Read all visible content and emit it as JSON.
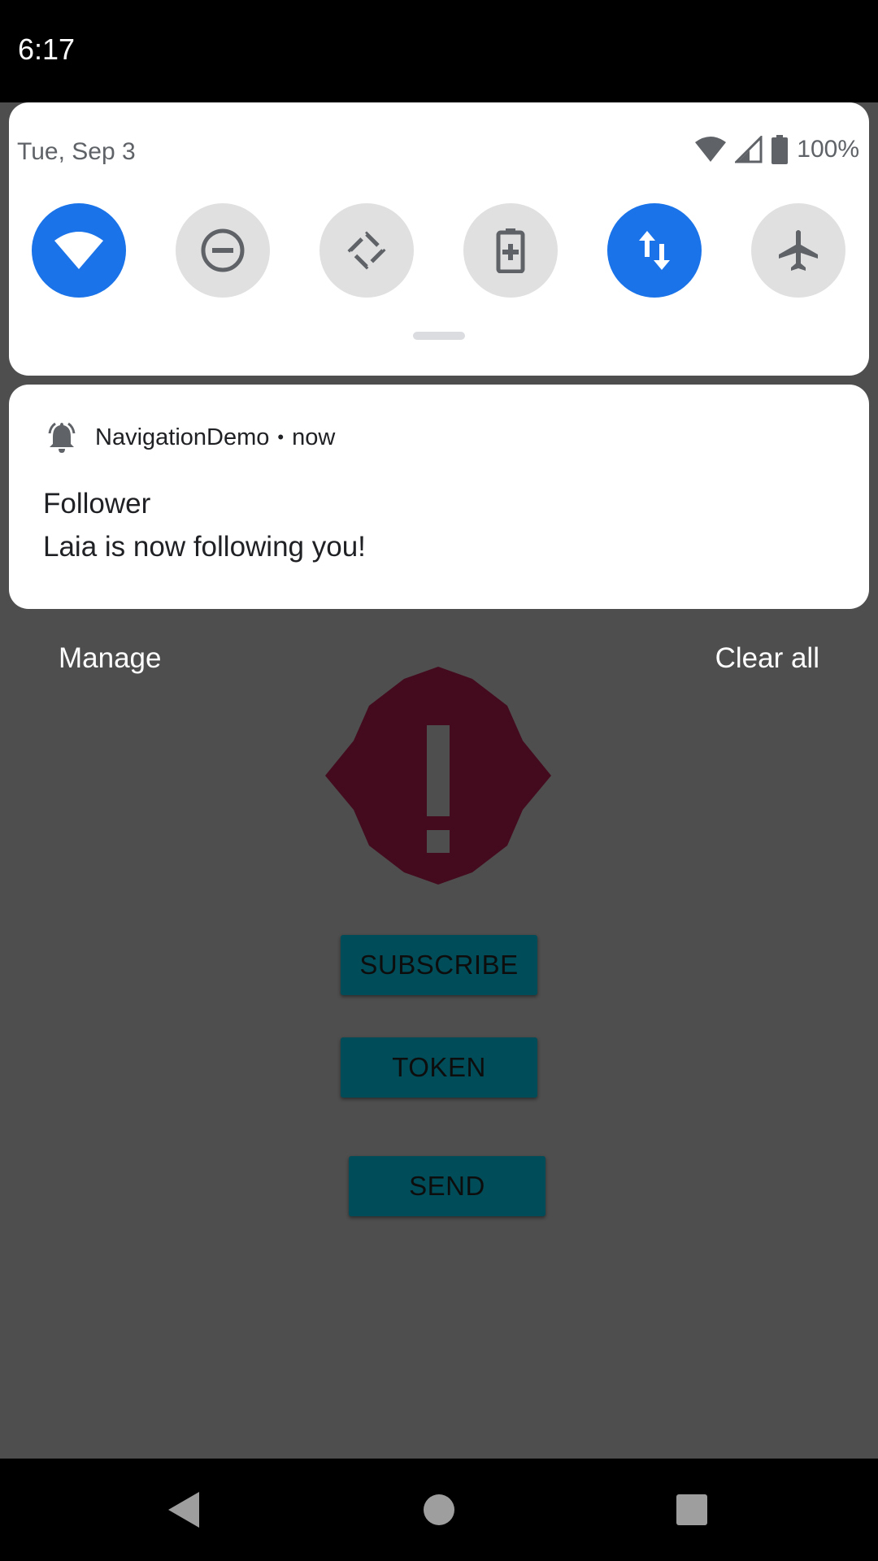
{
  "status_bar": {
    "time": "6:17"
  },
  "quick_settings": {
    "date": "Tue, Sep 3",
    "battery_percent": "100%",
    "tiles": [
      {
        "icon": "wifi-icon",
        "state": "on"
      },
      {
        "icon": "do-not-disturb-icon",
        "state": "off"
      },
      {
        "icon": "auto-rotate-icon",
        "state": "off"
      },
      {
        "icon": "battery-saver-icon",
        "state": "off"
      },
      {
        "icon": "mobile-data-icon",
        "state": "on"
      },
      {
        "icon": "airplane-mode-icon",
        "state": "off"
      }
    ],
    "accent_color": "#1a73e8"
  },
  "notification": {
    "app_name": "NavigationDemo",
    "time": "now",
    "separator": "•",
    "title": "Follower",
    "text": "Laia is now following you!"
  },
  "shade_actions": {
    "manage": "Manage",
    "clear_all": "Clear all"
  },
  "app": {
    "buttons": {
      "subscribe": "SUBSCRIBE",
      "token": "TOKEN",
      "send": "SEND"
    },
    "badge_color": "#440b1e",
    "button_color": "#004c58"
  },
  "nav_bar": {
    "icons": [
      "back-icon",
      "home-icon",
      "recents-icon"
    ]
  }
}
